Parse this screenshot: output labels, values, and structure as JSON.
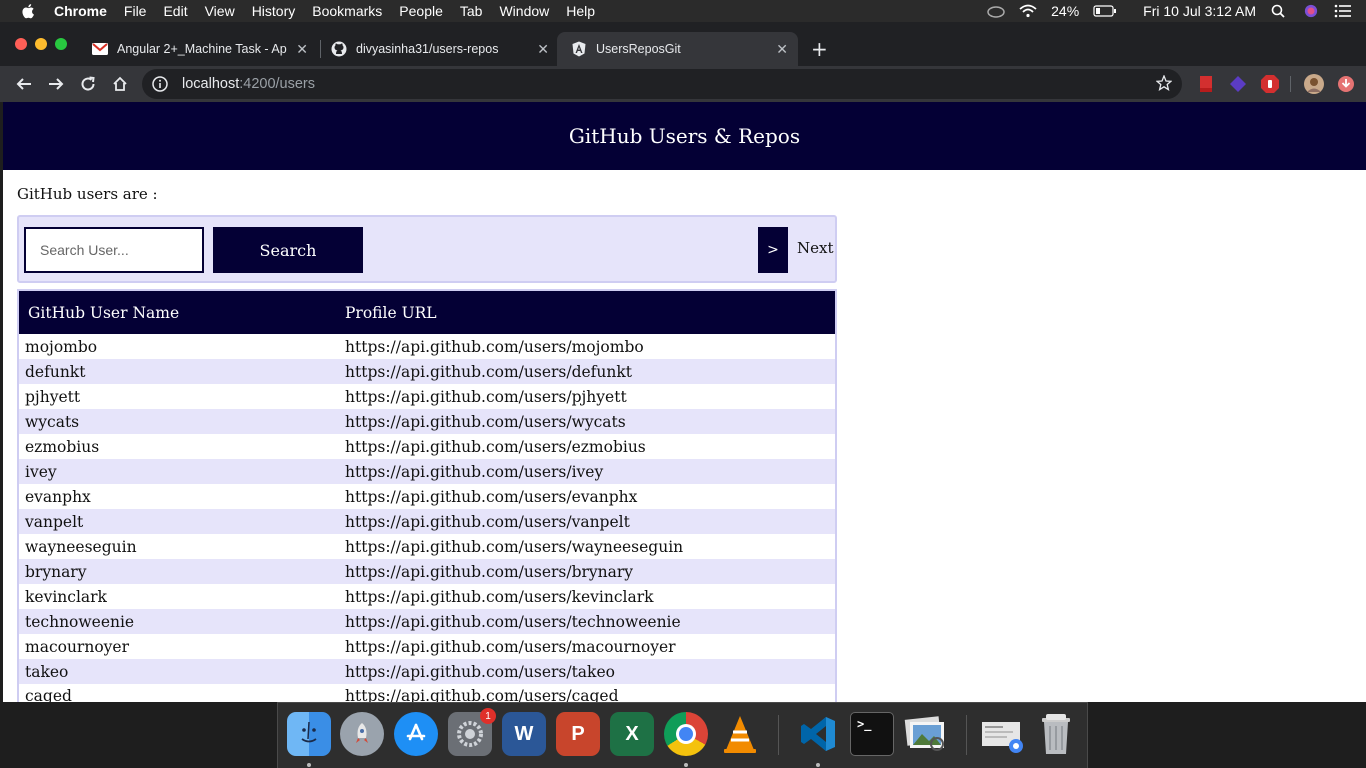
{
  "menubar": {
    "app_name": "Chrome",
    "items": [
      "File",
      "Edit",
      "View",
      "History",
      "Bookmarks",
      "People",
      "Tab",
      "Window",
      "Help"
    ],
    "battery": "24%",
    "datetime": "Fri 10 Jul  3:12 AM"
  },
  "browser": {
    "tabs": [
      {
        "title": "Angular 2+_Machine Task - Ap"
      },
      {
        "title": "divyasinha31/users-repos"
      },
      {
        "title": "UsersReposGit"
      }
    ],
    "url_host": "localhost",
    "url_rest": ":4200/users"
  },
  "page": {
    "header_title": "GitHub Users & Repos",
    "intro_text": "GitHub users are :",
    "search_placeholder": "Search User...",
    "search_button": "Search",
    "next_arrow": ">",
    "next_label": "Next",
    "table": {
      "headers": [
        "GitHub User Name",
        "Profile URL"
      ],
      "rows": [
        [
          "mojombo",
          "https://api.github.com/users/mojombo"
        ],
        [
          "defunkt",
          "https://api.github.com/users/defunkt"
        ],
        [
          "pjhyett",
          "https://api.github.com/users/pjhyett"
        ],
        [
          "wycats",
          "https://api.github.com/users/wycats"
        ],
        [
          "ezmobius",
          "https://api.github.com/users/ezmobius"
        ],
        [
          "ivey",
          "https://api.github.com/users/ivey"
        ],
        [
          "evanphx",
          "https://api.github.com/users/evanphx"
        ],
        [
          "vanpelt",
          "https://api.github.com/users/vanpelt"
        ],
        [
          "wayneeseguin",
          "https://api.github.com/users/wayneeseguin"
        ],
        [
          "brynary",
          "https://api.github.com/users/brynary"
        ],
        [
          "kevinclark",
          "https://api.github.com/users/kevinclark"
        ],
        [
          "technoweenie",
          "https://api.github.com/users/technoweenie"
        ],
        [
          "macournoyer",
          "https://api.github.com/users/macournoyer"
        ],
        [
          "takeo",
          "https://api.github.com/users/takeo"
        ],
        [
          "caged",
          "https://api.github.com/users/caged"
        ]
      ]
    }
  },
  "dock": {
    "icons": [
      "finder-icon",
      "launchpad-icon",
      "app-store-icon",
      "system-preferences-icon",
      "word-icon",
      "powerpoint-icon",
      "excel-icon",
      "chrome-icon",
      "vlc-icon",
      "vscode-icon",
      "terminal-icon",
      "preview-icon",
      "downloads-stack-icon",
      "trash-icon"
    ],
    "sys_prefs_badge": "1",
    "word_letter": "W",
    "ppt_letter": "P",
    "excel_letter": "X",
    "terminal_prompt": ">_"
  },
  "colors": {
    "brand_navy": "#040035",
    "row_alt": "#e6e4fa"
  }
}
